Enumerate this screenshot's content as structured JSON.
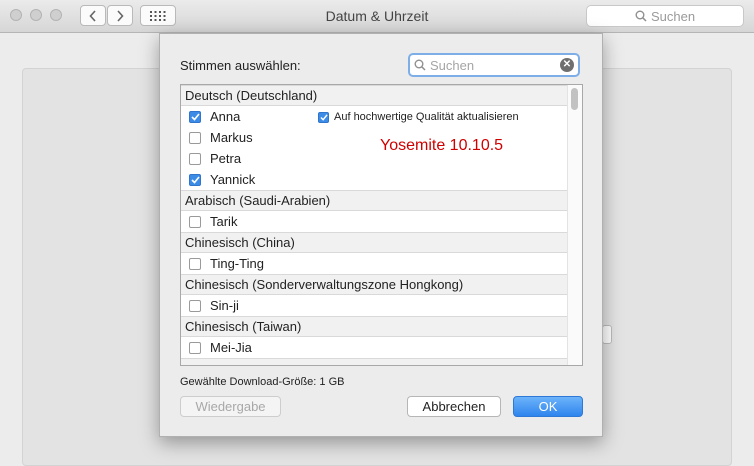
{
  "window": {
    "title": "Datum & Uhrzeit",
    "search_placeholder": "Suchen"
  },
  "sheet": {
    "label": "Stimmen auswählen:",
    "search_placeholder": "Suchen",
    "quality_label": "Auf hochwertige Qualität aktualisieren",
    "quality_checked": true,
    "annotation": "Yosemite 10.10.5",
    "download_size": "Gewählte Download-Größe: 1 GB",
    "buttons": {
      "play": "Wiedergabe",
      "cancel": "Abbrechen",
      "ok": "OK"
    },
    "groups": [
      {
        "label": "Deutsch (Deutschland)",
        "voices": [
          {
            "name": "Anna",
            "checked": true
          },
          {
            "name": "Markus",
            "checked": false
          },
          {
            "name": "Petra",
            "checked": false
          },
          {
            "name": "Yannick",
            "checked": true
          }
        ]
      },
      {
        "label": "Arabisch (Saudi-Arabien)",
        "voices": [
          {
            "name": "Tarik",
            "checked": false
          }
        ]
      },
      {
        "label": "Chinesisch (China)",
        "voices": [
          {
            "name": "Ting-Ting",
            "checked": false
          }
        ]
      },
      {
        "label": "Chinesisch (Sonderverwaltungszone Hongkong)",
        "voices": [
          {
            "name": "Sin-ji",
            "checked": false
          }
        ]
      },
      {
        "label": "Chinesisch (Taiwan)",
        "voices": [
          {
            "name": "Mei-Jia",
            "checked": false
          }
        ]
      }
    ]
  },
  "colors": {
    "accent": "#3c8ce7",
    "annotation": "#d00000"
  }
}
